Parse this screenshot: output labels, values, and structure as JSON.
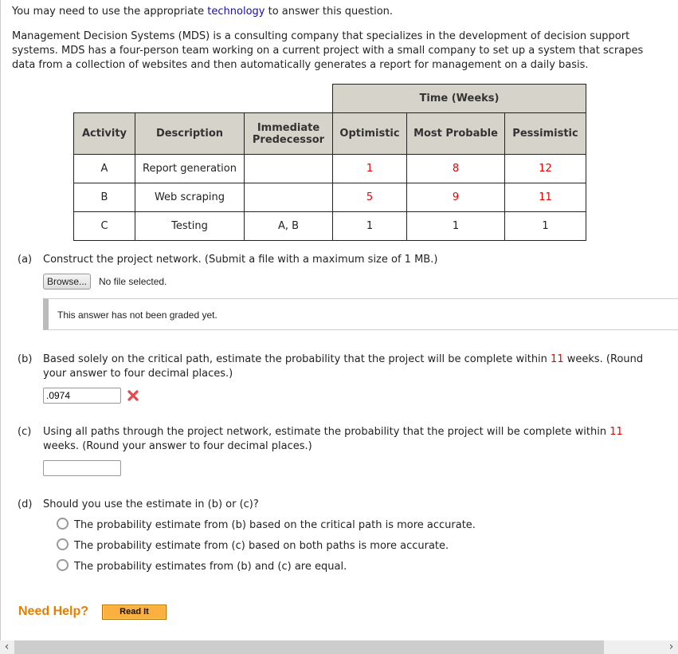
{
  "intro": {
    "prefix": "You may need to use the appropriate ",
    "link": "technology",
    "suffix": " to answer this question."
  },
  "problem_text_lines": [
    "Management Decision Systems (MDS) is a consulting company that specializes in the development of decision support",
    "systems. MDS has a four-person team working on a current project with a small company to set up a system that scrapes",
    "data from a collection of websites and then automatically generates a report for management on a daily basis."
  ],
  "table": {
    "group_header": "Time (Weeks)",
    "headers": [
      "Activity",
      "Description",
      "Immediate Predecessor",
      "Optimistic",
      "Most Probable",
      "Pessimistic"
    ],
    "header_predecessor_lines": [
      "Immediate",
      "Predecessor"
    ],
    "rows": [
      {
        "activity": "A",
        "description": "Report generation",
        "predecessor": "",
        "optimistic": "1",
        "most_probable": "8",
        "pessimistic": "12"
      },
      {
        "activity": "B",
        "description": "Web scraping",
        "predecessor": "",
        "optimistic": "5",
        "most_probable": "9",
        "pessimistic": "11"
      },
      {
        "activity": "C",
        "description": "Testing",
        "predecessor": "A, B",
        "optimistic": "1",
        "most_probable": "1",
        "pessimistic": "1"
      }
    ]
  },
  "part_a": {
    "label": "(a)",
    "text": "Construct the project network. (Submit a file with a maximum size of 1 MB.)",
    "browse_label": "Browse...",
    "file_status": "No file selected.",
    "graded_status": "This answer has not been graded yet."
  },
  "part_b": {
    "label": "(b)",
    "text_pre": "Based solely on the critical path, estimate the probability that the project will be complete within ",
    "weeks": "11",
    "text_post": " weeks. (Round",
    "text_line2": "your answer to four decimal places.)",
    "answer_value": ".0974",
    "result_icon": "incorrect-x-icon"
  },
  "part_c": {
    "label": "(c)",
    "text_pre": "Using all paths through the project network, estimate the probability that the project will be complete within ",
    "weeks": "11",
    "text_line2": "weeks. (Round your answer to four decimal places.)",
    "answer_value": ""
  },
  "part_d": {
    "label": "(d)",
    "text": "Should you use the estimate in (b) or (c)?",
    "options": [
      "The probability estimate from (b) based on the critical path is more accurate.",
      "The probability estimate from (c) based on both paths is more accurate.",
      "The probability estimates from (b) and (c) are equal."
    ]
  },
  "help": {
    "label": "Need Help?",
    "read_it": "Read It"
  },
  "colors": {
    "link": "#1a0dab",
    "highlight_red": "#ee0000",
    "table_header_bg": "#d6d3cb",
    "help_orange": "#e67e00",
    "read_it_bg": "#fbb040"
  }
}
